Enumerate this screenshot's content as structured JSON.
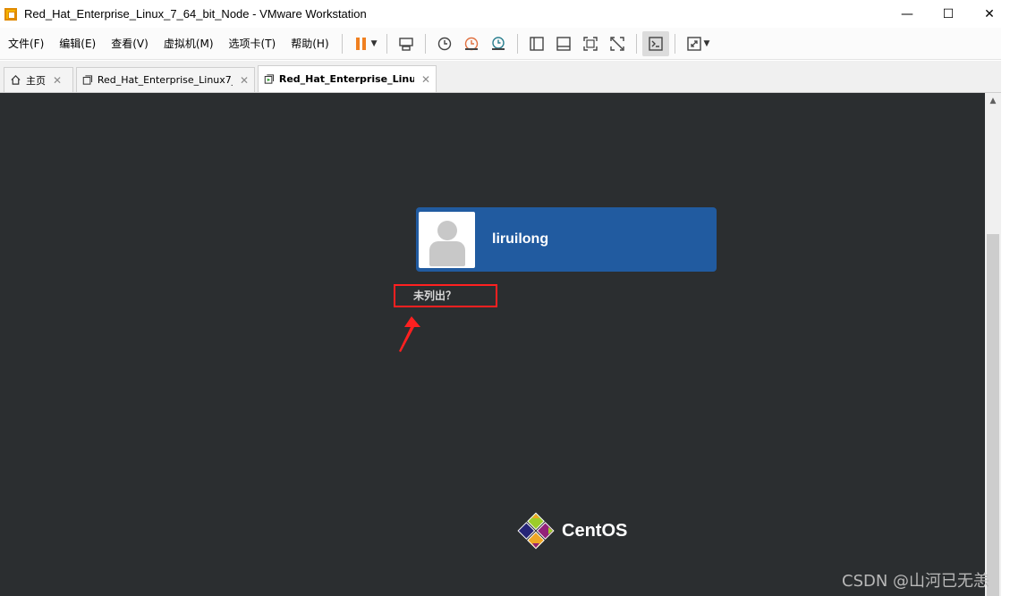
{
  "window": {
    "title": "Red_Hat_Enterprise_Linux_7_64_bit_Node - VMware Workstation",
    "minimize_label": "—",
    "maximize_label": "☐",
    "close_label": "✕"
  },
  "menu": {
    "items": [
      "文件(F)",
      "编辑(E)",
      "查看(V)",
      "虚拟机(M)",
      "选项卡(T)",
      "帮助(H)"
    ]
  },
  "toolbar": {
    "icons": [
      "pause-icon",
      "send-ctrl-alt-del-icon",
      "snapshot-take-icon",
      "snapshot-revert-icon",
      "snapshot-manager-icon",
      "library-view-icon",
      "single-view-icon",
      "fullscreen-icon",
      "unity-icon",
      "console-view-icon",
      "stretch-icon"
    ]
  },
  "tabs": [
    {
      "label": "主页",
      "icon": "home-icon",
      "active": false
    },
    {
      "label": "Red_Hat_Enterprise_Linux7_...",
      "icon": "vm-icon",
      "active": false
    },
    {
      "label": "Red_Hat_Enterprise_Linu...",
      "icon": "vm-running-icon",
      "active": true
    }
  ],
  "tab_close_label": "✕",
  "login": {
    "username": "liruilong",
    "not_listed": "未列出？"
  },
  "branding": {
    "os_name": "CentOS"
  },
  "watermark": "CSDN @山河已无恙",
  "colors": {
    "vm_background": "#2b2e30",
    "user_card": "#215ba0",
    "highlight": "#ff2020",
    "pause_accent": "#f08020"
  }
}
